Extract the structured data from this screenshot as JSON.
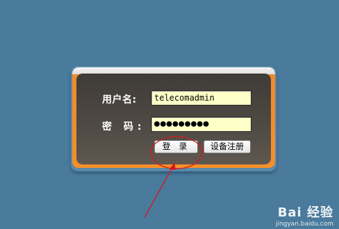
{
  "form": {
    "username_label": "用户名:",
    "password_label": "密 码:",
    "username_value": "telecomadmin",
    "password_value": "●●●●●●●●●",
    "login_button": "登 录",
    "register_button": "设备注册"
  },
  "watermark": {
    "logo_text": "Bai 经验",
    "url": "jingyan.baidu.com"
  },
  "colors": {
    "background": "#4a7a9c",
    "panel_dark": "#45403b",
    "panel_orange": "#f08a2a",
    "input_bg": "#ffffc8",
    "annotation_red": "#d81818"
  }
}
